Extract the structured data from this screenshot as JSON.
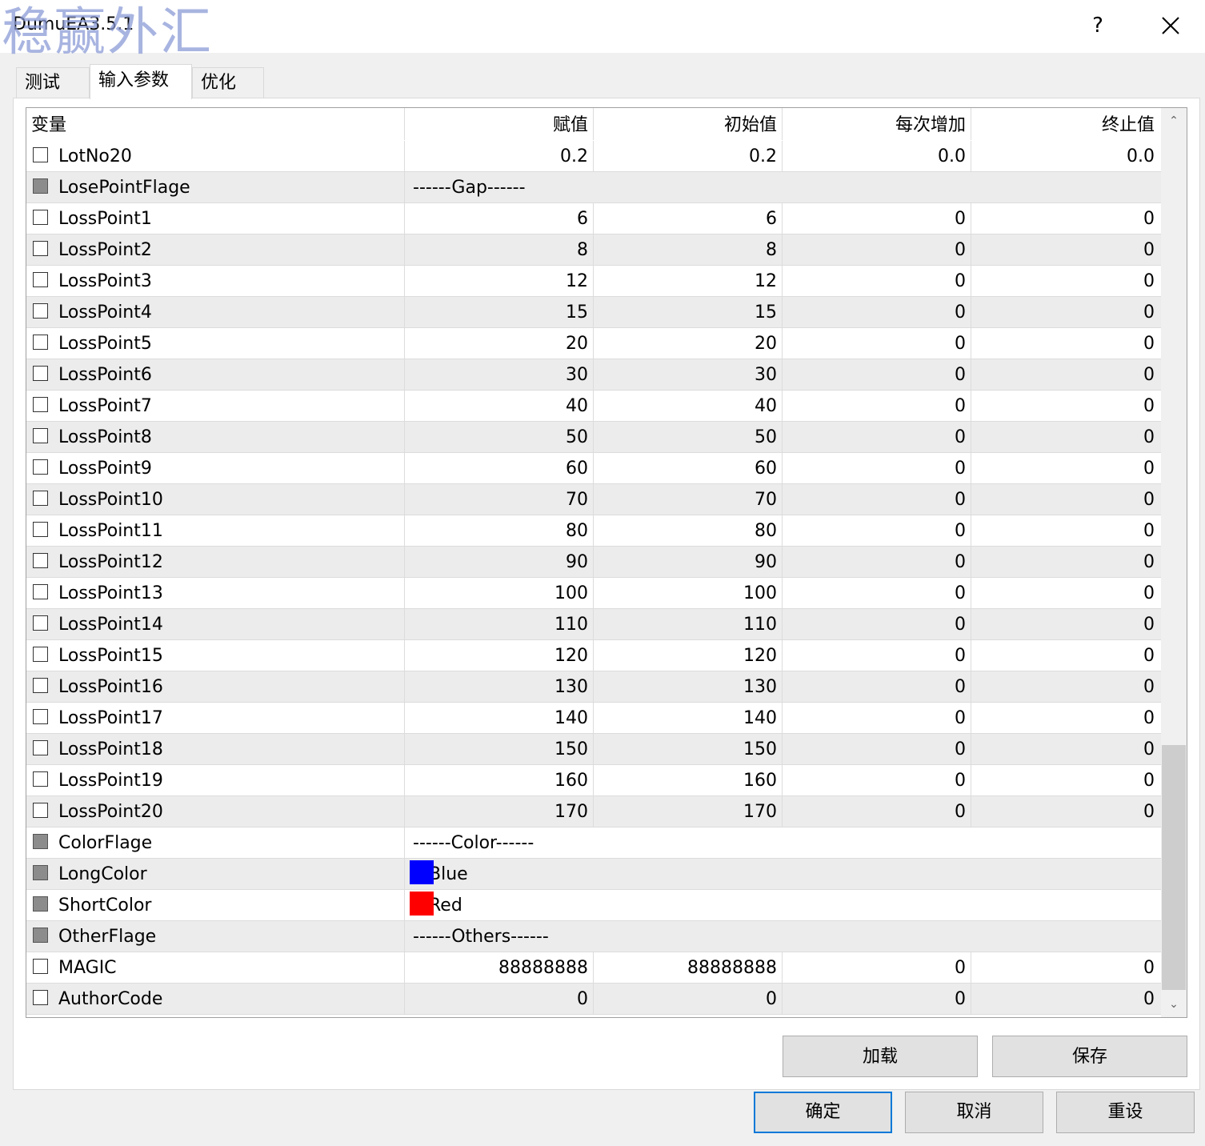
{
  "window": {
    "title": "DumuEA3.5.1",
    "watermark": "稳赢外汇",
    "help_label": "?"
  },
  "tabs": [
    {
      "label": "测试",
      "active": false
    },
    {
      "label": "输入参数",
      "active": true
    },
    {
      "label": "优化",
      "active": false
    }
  ],
  "table": {
    "headers": [
      "变量",
      "赋值",
      "初始值",
      "每次增加",
      "终止值"
    ],
    "rows": [
      {
        "name": "LotNo20",
        "checked": false,
        "flag": false,
        "value": "0.2",
        "start": "0.2",
        "step": "0.0",
        "stop": "0.0"
      },
      {
        "name": "LosePointFlage",
        "flag": true,
        "text": "------Gap------"
      },
      {
        "name": "LossPoint1",
        "flag": false,
        "value": "6",
        "start": "6",
        "step": "0",
        "stop": "0"
      },
      {
        "name": "LossPoint2",
        "flag": false,
        "value": "8",
        "start": "8",
        "step": "0",
        "stop": "0"
      },
      {
        "name": "LossPoint3",
        "flag": false,
        "value": "12",
        "start": "12",
        "step": "0",
        "stop": "0"
      },
      {
        "name": "LossPoint4",
        "flag": false,
        "value": "15",
        "start": "15",
        "step": "0",
        "stop": "0"
      },
      {
        "name": "LossPoint5",
        "flag": false,
        "value": "20",
        "start": "20",
        "step": "0",
        "stop": "0"
      },
      {
        "name": "LossPoint6",
        "flag": false,
        "value": "30",
        "start": "30",
        "step": "0",
        "stop": "0"
      },
      {
        "name": "LossPoint7",
        "flag": false,
        "value": "40",
        "start": "40",
        "step": "0",
        "stop": "0"
      },
      {
        "name": "LossPoint8",
        "flag": false,
        "value": "50",
        "start": "50",
        "step": "0",
        "stop": "0"
      },
      {
        "name": "LossPoint9",
        "flag": false,
        "value": "60",
        "start": "60",
        "step": "0",
        "stop": "0"
      },
      {
        "name": "LossPoint10",
        "flag": false,
        "value": "70",
        "start": "70",
        "step": "0",
        "stop": "0"
      },
      {
        "name": "LossPoint11",
        "flag": false,
        "value": "80",
        "start": "80",
        "step": "0",
        "stop": "0"
      },
      {
        "name": "LossPoint12",
        "flag": false,
        "value": "90",
        "start": "90",
        "step": "0",
        "stop": "0"
      },
      {
        "name": "LossPoint13",
        "flag": false,
        "value": "100",
        "start": "100",
        "step": "0",
        "stop": "0"
      },
      {
        "name": "LossPoint14",
        "flag": false,
        "value": "110",
        "start": "110",
        "step": "0",
        "stop": "0"
      },
      {
        "name": "LossPoint15",
        "flag": false,
        "value": "120",
        "start": "120",
        "step": "0",
        "stop": "0"
      },
      {
        "name": "LossPoint16",
        "flag": false,
        "value": "130",
        "start": "130",
        "step": "0",
        "stop": "0"
      },
      {
        "name": "LossPoint17",
        "flag": false,
        "value": "140",
        "start": "140",
        "step": "0",
        "stop": "0"
      },
      {
        "name": "LossPoint18",
        "flag": false,
        "value": "150",
        "start": "150",
        "step": "0",
        "stop": "0"
      },
      {
        "name": "LossPoint19",
        "flag": false,
        "value": "160",
        "start": "160",
        "step": "0",
        "stop": "0"
      },
      {
        "name": "LossPoint20",
        "flag": false,
        "value": "170",
        "start": "170",
        "step": "0",
        "stop": "0"
      },
      {
        "name": "ColorFlage",
        "flag": true,
        "text": "------Color------"
      },
      {
        "name": "LongColor",
        "flag": true,
        "color": "#0000ff",
        "text": "Blue"
      },
      {
        "name": "ShortColor",
        "flag": true,
        "color": "#ff0000",
        "text": "Red"
      },
      {
        "name": "OtherFlage",
        "flag": true,
        "text": "------Others------"
      },
      {
        "name": "MAGIC",
        "flag": false,
        "value": "88888888",
        "start": "88888888",
        "step": "0",
        "stop": "0"
      },
      {
        "name": "AuthorCode",
        "flag": false,
        "value": "0",
        "start": "0",
        "step": "0",
        "stop": "0"
      }
    ]
  },
  "scrollbar": {
    "up_icon": "chevron-up-icon",
    "down_icon": "chevron-down-icon",
    "up_glyph": "⌃",
    "down_glyph": "⌄"
  },
  "buttons": {
    "load": "加载",
    "save": "保存",
    "ok": "确定",
    "cancel": "取消",
    "reset": "重设"
  },
  "colors": {
    "accent": "#0078d7",
    "row_alt": "#ececec"
  }
}
